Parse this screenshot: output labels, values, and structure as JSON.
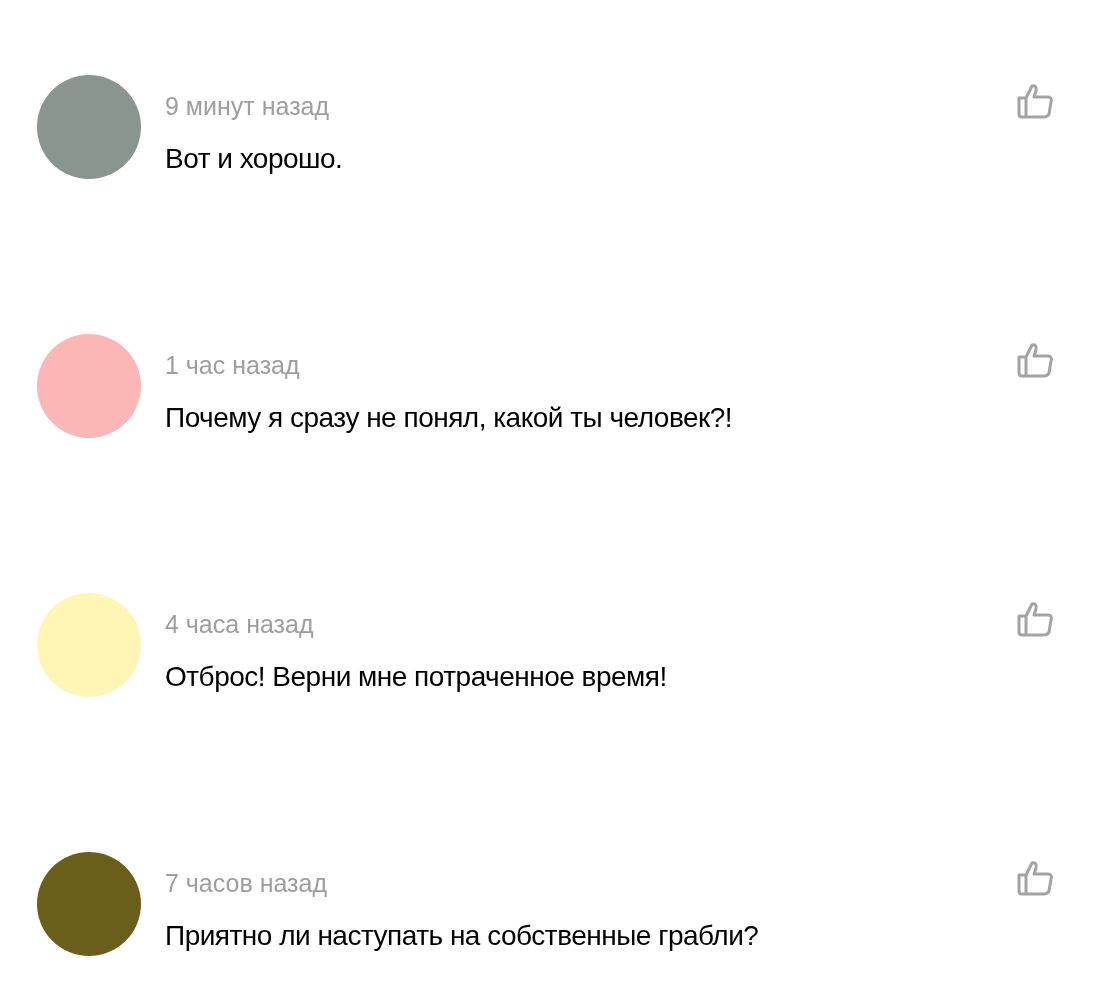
{
  "comments": [
    {
      "color": "#89958f",
      "time": "9 минут назад",
      "text": "Вот и хорошо."
    },
    {
      "color": "#fbb6b5",
      "time": "1 час назад",
      "text": "Почему я сразу не понял, какой ты человек?!"
    },
    {
      "color": "#fff6b5",
      "time": "4 часа назад",
      "text": "Отброс! Верни мне потраченное время!"
    },
    {
      "color": "#6a5f1a",
      "time": "7 часов назад",
      "text": "Приятно ли наступать на собственные грабли?"
    }
  ]
}
